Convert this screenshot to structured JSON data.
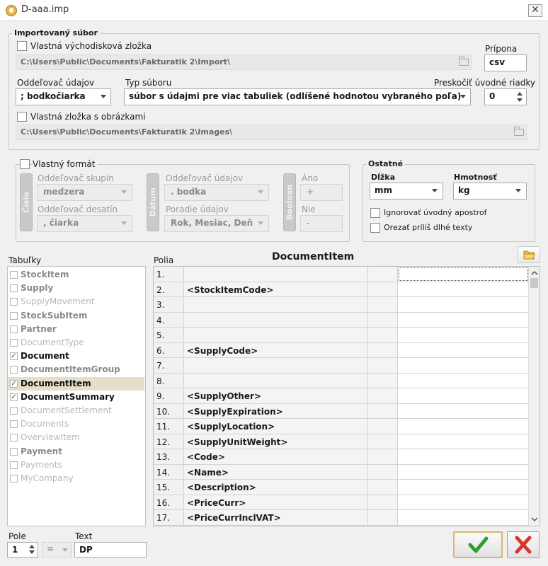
{
  "window": {
    "title": "D-aaa.imp",
    "close_glyph": "✕"
  },
  "import_group": {
    "legend": "Importovaný súbor",
    "custom_source_folder": {
      "label": "Vlastná východisková zložka",
      "checked": false
    },
    "source_path": "C:\\Users\\Public\\Documents\\Fakturatik 2\\Import\\",
    "extension": {
      "label": "Prípona",
      "value": "csv"
    },
    "delimiter": {
      "label": "Oddeľovač údajov",
      "value": "; bodkočiarka"
    },
    "file_type": {
      "label": "Typ súboru",
      "value": "súbor s údajmi pre viac tabuliek (odlíšené hodnotou vybraného poľa)"
    },
    "skip_rows": {
      "label": "Preskočiť úvodné riadky",
      "value": "0"
    },
    "custom_images_folder": {
      "label": "Vlastná zložka s obrázkami",
      "checked": false
    },
    "images_path": "C:\\Users\\Public\\Documents\\Fakturatik 2\\Images\\"
  },
  "custom_format": {
    "legend": "Vlastný formát",
    "number_tab": "Číslo",
    "group_separator": {
      "label": "Oddeľovač skupín",
      "value": "medzera"
    },
    "decimal_separator": {
      "label": "Oddeľovač desatín",
      "value": ", čiarka"
    },
    "date_tab": "Dátum",
    "date_separator": {
      "label": "Oddeľovač údajov",
      "value": ". bodka"
    },
    "date_order": {
      "label": "Poradie údajov",
      "value": "Rok, Mesiac, Deň"
    },
    "boolean_tab": "Boolean",
    "yes": {
      "label": "Áno",
      "value": "+"
    },
    "no": {
      "label": "Nie",
      "value": "-"
    }
  },
  "other": {
    "legend": "Ostatné",
    "length": {
      "label": "Dĺžka",
      "value": "mm"
    },
    "weight": {
      "label": "Hmotnosť",
      "value": "kg"
    },
    "ignore_apostrophe": {
      "label": "Ignorovať úvodný apostrof",
      "checked": false
    },
    "truncate_texts": {
      "label": "Orezať príliš dlhé texty",
      "checked": false
    }
  },
  "tables": {
    "label": "Tabuľky",
    "items": [
      {
        "name": "StockItem",
        "checked": false,
        "enabled": true,
        "selected": false
      },
      {
        "name": "Supply",
        "checked": false,
        "enabled": true,
        "selected": false
      },
      {
        "name": "SupplyMovement",
        "checked": false,
        "enabled": false,
        "selected": false
      },
      {
        "name": "StockSubItem",
        "checked": false,
        "enabled": true,
        "selected": false
      },
      {
        "name": "Partner",
        "checked": false,
        "enabled": true,
        "selected": false
      },
      {
        "name": "DocumentType",
        "checked": false,
        "enabled": false,
        "selected": false
      },
      {
        "name": "Document",
        "checked": true,
        "enabled": true,
        "selected": false
      },
      {
        "name": "DocumentItemGroup",
        "checked": false,
        "enabled": true,
        "selected": false
      },
      {
        "name": "DocumentItem",
        "checked": true,
        "enabled": true,
        "selected": true
      },
      {
        "name": "DocumentSummary",
        "checked": true,
        "enabled": true,
        "selected": false
      },
      {
        "name": "DocumentSettlement",
        "checked": false,
        "enabled": false,
        "selected": false
      },
      {
        "name": "Documents",
        "checked": false,
        "enabled": false,
        "selected": false
      },
      {
        "name": "OverviewItem",
        "checked": false,
        "enabled": false,
        "selected": false
      },
      {
        "name": "Payment",
        "checked": false,
        "enabled": true,
        "selected": false
      },
      {
        "name": "Payments",
        "checked": false,
        "enabled": false,
        "selected": false
      },
      {
        "name": "MyCompany",
        "checked": false,
        "enabled": false,
        "selected": false
      }
    ],
    "colors": {
      "enabled": "#8a8a8a",
      "active": "#111111",
      "disabled": "#b8b8b8",
      "selected_bg": "#e3dfc9"
    }
  },
  "fields": {
    "label": "Polia",
    "table_title": "DocumentItem",
    "rows": [
      {
        "num": "1.",
        "code": ""
      },
      {
        "num": "2.",
        "code": "<StockItemCode>"
      },
      {
        "num": "3.",
        "code": ""
      },
      {
        "num": "4.",
        "code": ""
      },
      {
        "num": "5.",
        "code": ""
      },
      {
        "num": "6.",
        "code": "<SupplyCode>"
      },
      {
        "num": "7.",
        "code": ""
      },
      {
        "num": "8.",
        "code": ""
      },
      {
        "num": "9.",
        "code": "<SupplyOther>"
      },
      {
        "num": "10.",
        "code": "<SupplyExpiration>"
      },
      {
        "num": "11.",
        "code": "<SupplyLocation>"
      },
      {
        "num": "12.",
        "code": "<SupplyUnitWeight>"
      },
      {
        "num": "13.",
        "code": "<Code>"
      },
      {
        "num": "14.",
        "code": "<Name>"
      },
      {
        "num": "15.",
        "code": "<Description>"
      },
      {
        "num": "16.",
        "code": "<PriceCurr>"
      },
      {
        "num": "17.",
        "code": "<PriceCurrInclVAT>"
      }
    ]
  },
  "filter": {
    "field_label": "Pole",
    "field_value": "1",
    "operator": "=",
    "text_label": "Text",
    "text_value": "DP"
  },
  "buttons": {
    "ok": "ok-check",
    "cancel": "cancel-x"
  }
}
